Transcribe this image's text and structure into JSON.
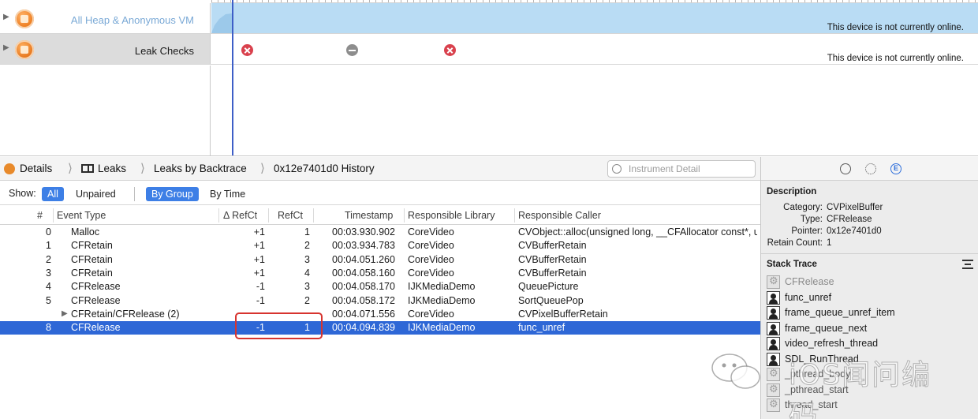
{
  "tracks": [
    {
      "name": "All Heap & Anonymous VM",
      "status": "This device is not currently online."
    },
    {
      "name": "Leak Checks",
      "status": "This device is not currently online."
    }
  ],
  "jumpbar": {
    "details": "Details",
    "leaks": "Leaks",
    "backtrace": "Leaks by Backtrace",
    "history": "0x12e7401d0 History",
    "search_placeholder": "Instrument Detail"
  },
  "filter": {
    "show_label": "Show:",
    "all": "All",
    "unpaired": "Unpaired",
    "by_group": "By Group",
    "by_time": "By Time"
  },
  "table": {
    "columns": [
      "#",
      "Event Type",
      "Δ RefCt",
      "RefCt",
      "Timestamp",
      "Responsible Library",
      "Responsible Caller"
    ],
    "rows": [
      {
        "num": "0",
        "type": "Malloc",
        "delta": "+1",
        "refct": "1",
        "ts": "00:03.930.902",
        "lib": "CoreVideo",
        "caller": "CVObject::alloc(unsigned long, __CFAllocator const*, unsigne"
      },
      {
        "num": "1",
        "type": "CFRetain",
        "delta": "+1",
        "refct": "2",
        "ts": "00:03.934.783",
        "lib": "CoreVideo",
        "caller": "CVBufferRetain"
      },
      {
        "num": "2",
        "type": "CFRetain",
        "delta": "+1",
        "refct": "3",
        "ts": "00:04.051.260",
        "lib": "CoreVideo",
        "caller": "CVBufferRetain"
      },
      {
        "num": "3",
        "type": "CFRetain",
        "delta": "+1",
        "refct": "4",
        "ts": "00:04.058.160",
        "lib": "CoreVideo",
        "caller": "CVBufferRetain"
      },
      {
        "num": "4",
        "type": "CFRelease",
        "delta": "-1",
        "refct": "3",
        "ts": "00:04.058.170",
        "lib": "IJKMediaDemo",
        "caller": "QueuePicture"
      },
      {
        "num": "5",
        "type": "CFRelease",
        "delta": "-1",
        "refct": "2",
        "ts": "00:04.058.172",
        "lib": "IJKMediaDemo",
        "caller": "SortQueuePop"
      },
      {
        "num": "",
        "type": "CFRetain/CFRelease (2)",
        "delta": "",
        "refct": "",
        "ts": "00:04.071.556",
        "lib": "CoreVideo",
        "caller": "CVPixelBufferRetain"
      },
      {
        "num": "8",
        "type": "CFRelease",
        "delta": "-1",
        "refct": "1",
        "ts": "00:04.094.839",
        "lib": "IJKMediaDemo",
        "caller": "func_unref"
      }
    ]
  },
  "inspector": {
    "description_title": "Description",
    "description": [
      {
        "key": "Category:",
        "value": "CVPixelBuffer"
      },
      {
        "key": "Type:",
        "value": "CFRelease"
      },
      {
        "key": "Pointer:",
        "value": "0x12e7401d0"
      },
      {
        "key": "Retain Count:",
        "value": "1"
      }
    ],
    "stack_title": "Stack Trace",
    "frames": [
      {
        "name": "CFRelease",
        "kind": "sys dim"
      },
      {
        "name": "func_unref",
        "kind": "user"
      },
      {
        "name": "frame_queue_unref_item",
        "kind": "user"
      },
      {
        "name": "frame_queue_next",
        "kind": "user"
      },
      {
        "name": "video_refresh_thread",
        "kind": "user"
      },
      {
        "name": "SDL_RunThread",
        "kind": "user"
      },
      {
        "name": "_pthread_body",
        "kind": "sys"
      },
      {
        "name": "_pthread_start",
        "kind": "sys"
      },
      {
        "name": "thread_start",
        "kind": "sys"
      }
    ]
  },
  "watermark": {
    "text": "iOS闻问编码"
  },
  "colors": {
    "selection": "#2e67d6",
    "accent": "#3d7fe6",
    "highlight_box": "#d7342f",
    "leak_marker": "#d9414d"
  }
}
